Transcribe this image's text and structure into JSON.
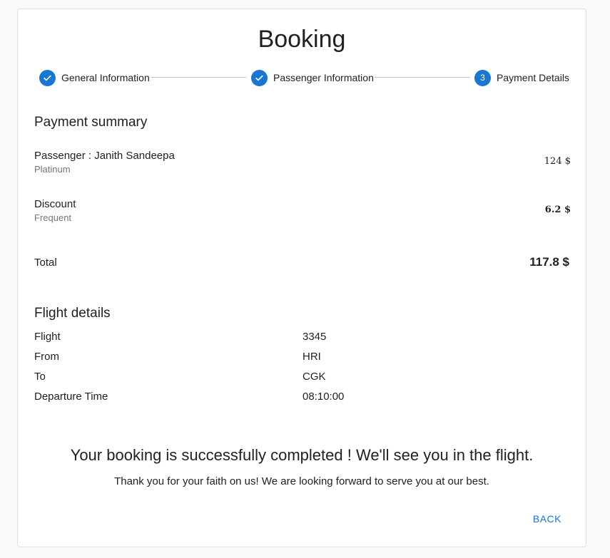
{
  "page": {
    "title": "Booking"
  },
  "stepper": {
    "steps": [
      {
        "label": "General Information",
        "state": "completed"
      },
      {
        "label": "Passenger Information",
        "state": "completed"
      },
      {
        "label": "Payment Details",
        "state": "active",
        "number": "3"
      }
    ]
  },
  "payment_summary": {
    "heading": "Payment summary",
    "passenger": {
      "label": "Passenger : Janith Sandeepa",
      "tier": "Platinum",
      "amount": "124 $"
    },
    "discount": {
      "label": "Discount",
      "type": "Frequent",
      "amount": "6.2 $"
    },
    "total": {
      "label": "Total",
      "amount": "117.8 $"
    }
  },
  "flight_details": {
    "heading": "Flight details",
    "rows": [
      {
        "key": "Flight",
        "value": "3345"
      },
      {
        "key": "From",
        "value": "HRI"
      },
      {
        "key": "To",
        "value": "CGK"
      },
      {
        "key": "Departure Time",
        "value": "08:10:00"
      }
    ]
  },
  "confirmation": {
    "message": "Your booking is successfully completed ! We'll see you in the flight.",
    "thanks": "Thank you for your faith on us! We are looking forward to serve you at our best."
  },
  "actions": {
    "back_label": "BACK"
  },
  "colors": {
    "accent": "#1976d2",
    "background": "#fafafa",
    "card": "#ffffff"
  }
}
